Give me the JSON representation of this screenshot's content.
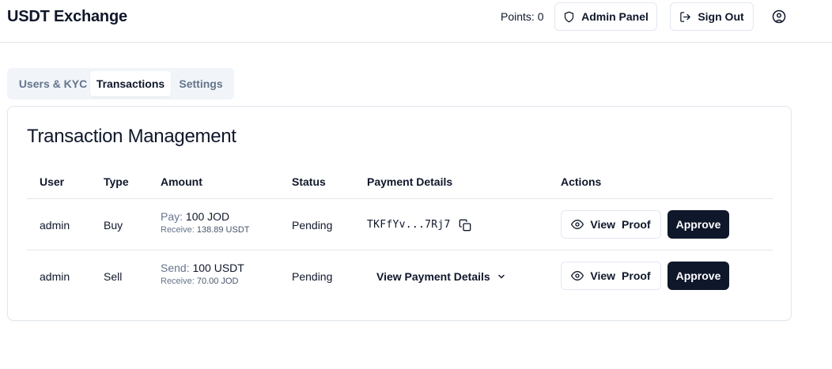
{
  "header": {
    "title": "USDT Exchange",
    "points": "Points: 0",
    "admin_label": "Admin Panel",
    "signout_label": "Sign Out"
  },
  "tabs": [
    {
      "label": "Users & KYC",
      "active": false
    },
    {
      "label": "Transactions",
      "active": true
    },
    {
      "label": "Settings",
      "active": false
    }
  ],
  "card": {
    "title": "Transaction Management",
    "columns": [
      "User",
      "Type",
      "Amount",
      "Status",
      "Payment Details",
      "Actions"
    ],
    "rows": [
      {
        "user": "admin",
        "type": "Buy",
        "amount_label": "Pay:",
        "amount_value": "100 JOD",
        "receive_label": "Receive:",
        "receive_value": "138.89 USDT",
        "status": "Pending",
        "payment_details": "TKFfYv...7Rj7",
        "view_proof_a": "View",
        "view_proof_b": "Proof",
        "approve": "Approve"
      },
      {
        "user": "admin",
        "type": "Sell",
        "amount_label": "Send:",
        "amount_value": "100 USDT",
        "receive_label": "Receive:",
        "receive_value": "70.00 JOD",
        "status": "Pending",
        "payment_details": "View Payment Details",
        "view_proof_a": "View",
        "view_proof_b": "Proof",
        "approve": "Approve"
      }
    ]
  },
  "icons": {
    "admin": "shield-icon",
    "signout": "log-out-icon",
    "user": "user-circle-icon",
    "copy": "copy-icon",
    "eye": "eye-icon",
    "chevron": "chevron-down-icon"
  },
  "colors": {
    "primary": "#0f172a",
    "muted": "#64748b",
    "border": "#e2e8f0",
    "tabs_bg": "#f1f5f9"
  }
}
